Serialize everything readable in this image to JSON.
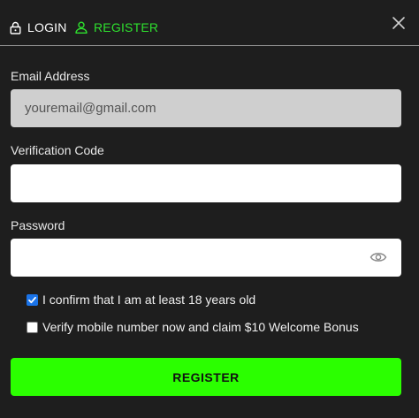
{
  "tabs": {
    "login_label": "LOGIN",
    "register_label": "REGISTER",
    "active": "register"
  },
  "icons": {
    "login": "lock-icon",
    "register": "user-icon",
    "close": "close-icon",
    "password_toggle": "eye-icon"
  },
  "form": {
    "email_label": "Email Address",
    "email_placeholder": "youremail@gmail.com",
    "email_value": "",
    "code_label": "Verification Code",
    "code_value": "",
    "password_label": "Password",
    "password_value": ""
  },
  "checkboxes": [
    {
      "label": "I confirm that I am at least 18 years old",
      "checked": true
    },
    {
      "label": "Verify mobile number now and claim $10 Welcome Bonus",
      "checked": false
    }
  ],
  "submit_label": "REGISTER",
  "colors": {
    "background": "#1e1e1e",
    "accent": "#2bff00",
    "active_tab": "#2ee02e",
    "checkbox_checked": "#1a73e8"
  }
}
